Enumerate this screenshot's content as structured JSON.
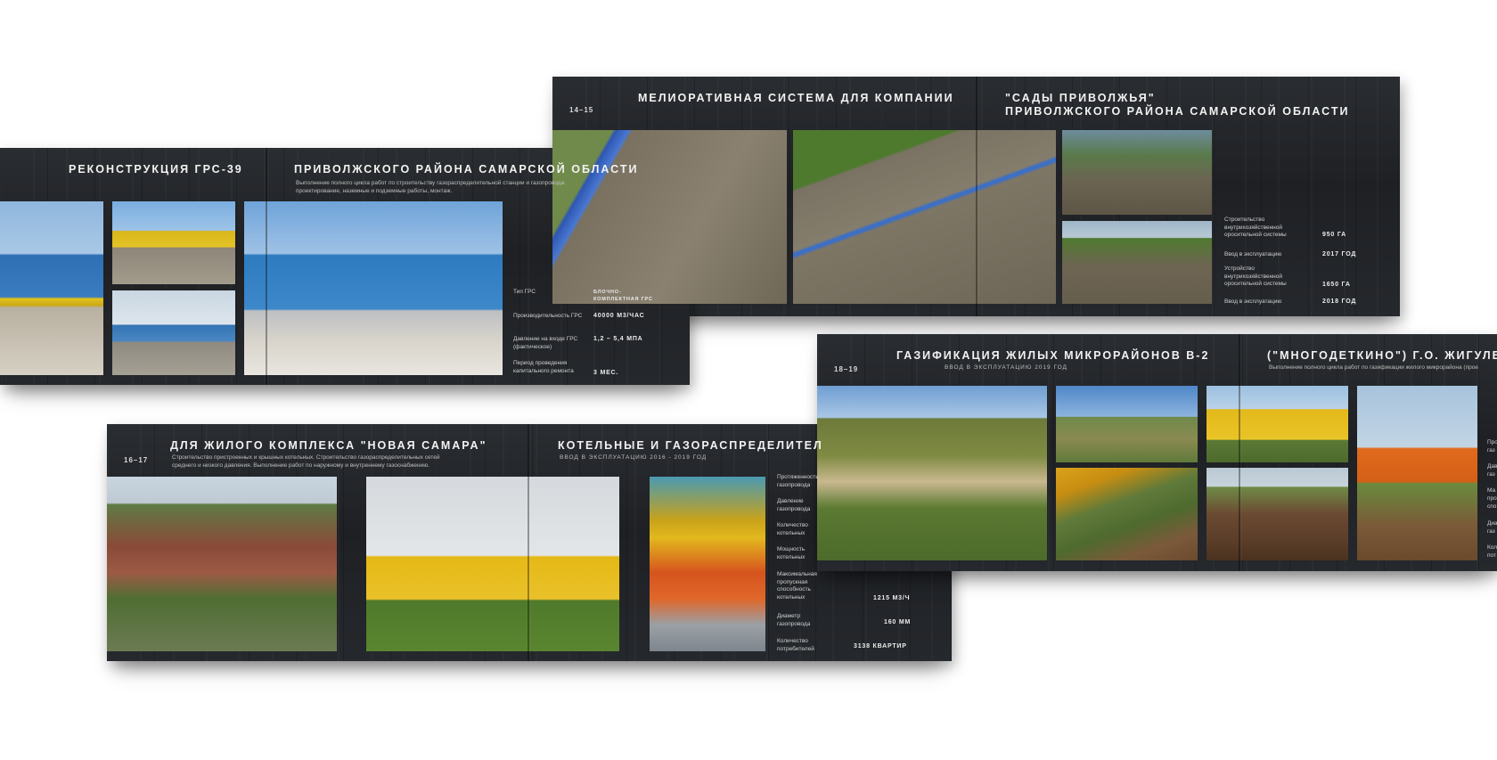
{
  "spreads": {
    "s1": {
      "left_title": "РЕКОНСТРУКЦИЯ ГРС-39",
      "right_title": "ПРИВОЛЖСКОГО РАЙОНА САМАРСКОЙ ОБЛАСТИ",
      "subtitle_line1": "Выполнение полного цикла работ по строительству газораспределительной станции и газопровода:",
      "subtitle_line2": "проектирование, наземные и подземные работы, монтаж.",
      "specs": [
        {
          "label": "Тип ГРС",
          "value": "БЛОЧНО-",
          "value2": "КОМПЛЕКТНАЯ ГРС"
        },
        {
          "label": "Производительность ГРС",
          "value": "40000 М3/ЧАС",
          "value2": ""
        },
        {
          "label": "Давление на входе ГРС",
          "label2": "(фактическое)",
          "value": "1,2 – 5,4 МПА",
          "value2": ""
        },
        {
          "label": "Период проведения",
          "label2": "капитального ремонта",
          "value": "3 МЕС.",
          "value2": ""
        }
      ]
    },
    "s2": {
      "page_num": "14–15",
      "left_title": "МЕЛИОРАТИВНАЯ СИСТЕМА ДЛЯ КОМПАНИИ",
      "right_title_line1": "\"САДЫ ПРИВОЛЖЬЯ\"",
      "right_title_line2": "ПРИВОЛЖСКОГО РАЙОНА САМАРСКОЙ ОБЛАСТИ",
      "specs": [
        {
          "label": "Строительство",
          "label2": "внутрихозяйственной",
          "label3": "оросительной системы",
          "value": "950 ГА"
        },
        {
          "label": "Ввод в эксплуатацию",
          "value": "2017 ГОД"
        },
        {
          "label": "Устройство",
          "label2": "внутрихозяйственной",
          "label3": "оросительной системы",
          "value": "1650 ГА"
        },
        {
          "label": "Ввод в эксплуатацию",
          "value": "2018 ГОД"
        }
      ]
    },
    "s3": {
      "page_num": "16–17",
      "left_title": "ДЛЯ ЖИЛОГО КОМПЛЕКСА \"НОВАЯ САМАРА\"",
      "left_sub_line1": "Строительство пристроенных и крышных котельных. Строительство газораспределительных сетей",
      "left_sub_line2": "среднего и низкого давления. Выполнение работ по наружному и внутреннему газоснабжению.",
      "right_title": "КОТЕЛЬНЫЕ И ГАЗОРАСПРЕДЕЛИТЕЛ",
      "right_sub": "ВВОД В ЭКСПЛУАТАЦИЮ 2016 - 2019 ГОД",
      "specs": [
        {
          "label": "Протяженность",
          "label2": "газопровода",
          "value": ""
        },
        {
          "label": "Давление",
          "label2": "газопровода",
          "value": ""
        },
        {
          "label": "Количество",
          "label2": "котельных",
          "value": ""
        },
        {
          "label": "Мощность",
          "label2": "котельных",
          "value": ""
        },
        {
          "label": "Максимальная",
          "label2": "пропускная",
          "label3": "способность",
          "label4": "котельных",
          "value": "1215 М3/Ч"
        },
        {
          "label": "Диаметр",
          "label2": "газопровода",
          "value": "160 ММ"
        },
        {
          "label": "Количество",
          "label2": "потребителей",
          "value": "3138 КВАРТИР"
        }
      ]
    },
    "s4": {
      "page_num": "18–19",
      "left_title": "ГАЗИФИКАЦИЯ ЖИЛЫХ МИКРОРАЙОНОВ В-2",
      "left_sub": "ВВОД В ЭКСПЛУАТАЦИЮ 2019 ГОД",
      "right_title": "(\"МНОГОДЕТКИНО\") Г.О. ЖИГУЛЕВ",
      "right_sub": "Выполнение полного цикла работ по газификации жилого микрорайона (прое",
      "edge_labels": [
        "Про",
        "газ",
        "Дав",
        "газ",
        "Ма",
        "про",
        "спо",
        "Диа",
        "газ",
        "Кол",
        "пот"
      ]
    }
  }
}
